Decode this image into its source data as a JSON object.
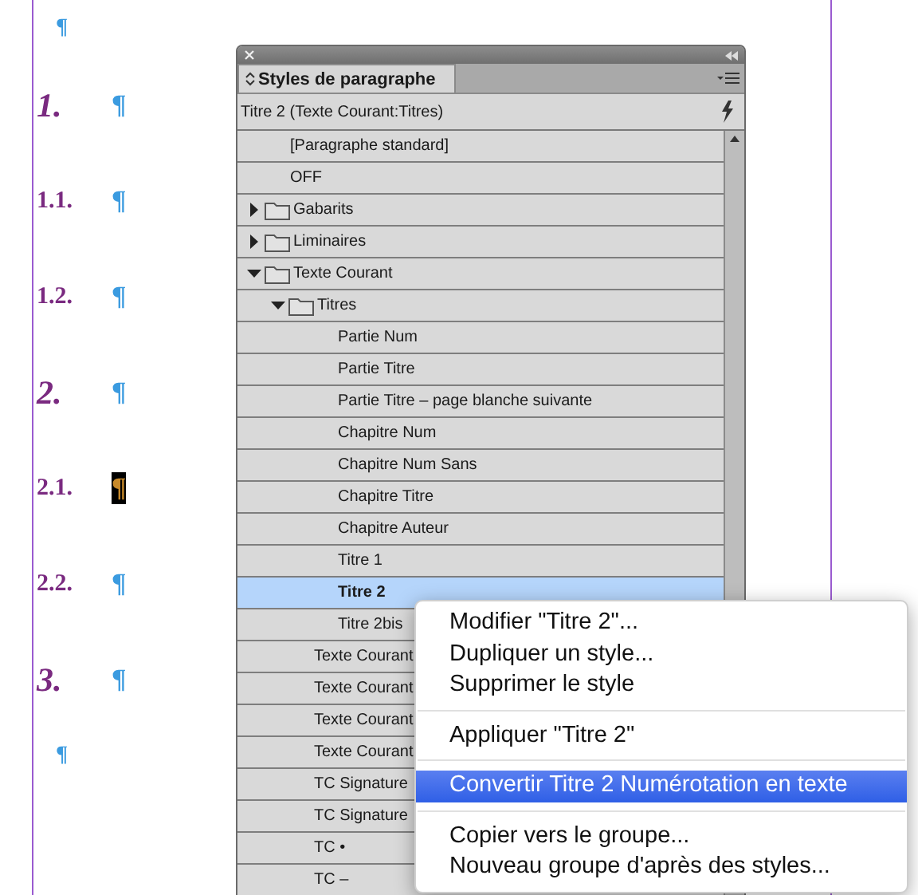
{
  "document": {
    "lines": [
      {
        "kind": "empty",
        "mark": "¶",
        "cursor": false
      },
      {
        "kind": "chapter",
        "number": "1.",
        "mark": "¶",
        "cursor": false
      },
      {
        "kind": "section",
        "number": "1.1.",
        "mark": "¶",
        "cursor": false
      },
      {
        "kind": "section",
        "number": "1.2.",
        "mark": "¶",
        "cursor": false
      },
      {
        "kind": "chapter",
        "number": "2.",
        "mark": "¶",
        "cursor": false
      },
      {
        "kind": "section",
        "number": "2.1.",
        "mark": "¶",
        "cursor": true
      },
      {
        "kind": "section",
        "number": "2.2.",
        "mark": "¶",
        "cursor": false
      },
      {
        "kind": "chapter",
        "number": "3.",
        "mark": "¶",
        "cursor": false
      },
      {
        "kind": "empty",
        "mark": "¶",
        "cursor": false
      }
    ]
  },
  "panel": {
    "tab": "Styles de paragraphe",
    "current_style": "Titre 2 (Texte Courant:Titres)",
    "styles": [
      {
        "kind": "style",
        "label": "[Paragraphe standard]",
        "selected": false
      },
      {
        "kind": "style",
        "label": "OFF",
        "selected": false
      },
      {
        "kind": "group",
        "label": "Gabarits",
        "expanded": false
      },
      {
        "kind": "group",
        "label": "Liminaires",
        "expanded": false
      },
      {
        "kind": "group",
        "label": "Texte Courant",
        "expanded": true,
        "children": [
          {
            "kind": "group",
            "label": "Titres",
            "expanded": true,
            "children": [
              {
                "kind": "style",
                "label": "Partie Num",
                "selected": false
              },
              {
                "kind": "style",
                "label": "Partie Titre",
                "selected": false
              },
              {
                "kind": "style",
                "label": "Partie Titre – page blanche suivante",
                "selected": false
              },
              {
                "kind": "style",
                "label": "Chapitre Num",
                "selected": false
              },
              {
                "kind": "style",
                "label": "Chapitre Num Sans",
                "selected": false
              },
              {
                "kind": "style",
                "label": "Chapitre Titre",
                "selected": false
              },
              {
                "kind": "style",
                "label": "Chapitre Auteur",
                "selected": false
              },
              {
                "kind": "style",
                "label": "Titre 1",
                "selected": false
              },
              {
                "kind": "style",
                "label": "Titre 2",
                "selected": true
              },
              {
                "kind": "style",
                "label": "Titre 2bis",
                "selected": false
              }
            ]
          },
          {
            "kind": "style",
            "label": "Texte Courant",
            "selected": false
          },
          {
            "kind": "style",
            "label": "Texte Courant",
            "selected": false
          },
          {
            "kind": "style",
            "label": "Texte Courant",
            "selected": false
          },
          {
            "kind": "style",
            "label": "Texte Courant",
            "selected": false
          },
          {
            "kind": "style",
            "label": "TC Signature",
            "selected": false
          },
          {
            "kind": "style",
            "label": "TC Signature",
            "selected": false
          },
          {
            "kind": "style",
            "label": "TC •",
            "selected": false
          },
          {
            "kind": "style",
            "label": "TC –",
            "selected": false
          }
        ]
      }
    ]
  },
  "context_menu": {
    "items": [
      {
        "kind": "item",
        "label": "Modifier \"Titre 2\"...",
        "selected": false
      },
      {
        "kind": "item",
        "label": "Dupliquer un style...",
        "selected": false
      },
      {
        "kind": "item",
        "label": "Supprimer le style",
        "selected": false
      },
      {
        "kind": "separator"
      },
      {
        "kind": "item",
        "label": "Appliquer \"Titre 2\"",
        "selected": false
      },
      {
        "kind": "separator"
      },
      {
        "kind": "item",
        "label": "Convertir Titre 2 Numérotation en texte",
        "selected": true
      },
      {
        "kind": "separator"
      },
      {
        "kind": "item",
        "label": "Copier vers le groupe...",
        "selected": false
      },
      {
        "kind": "item",
        "label": "Nouveau groupe d'après des styles...",
        "selected": false
      }
    ]
  }
}
